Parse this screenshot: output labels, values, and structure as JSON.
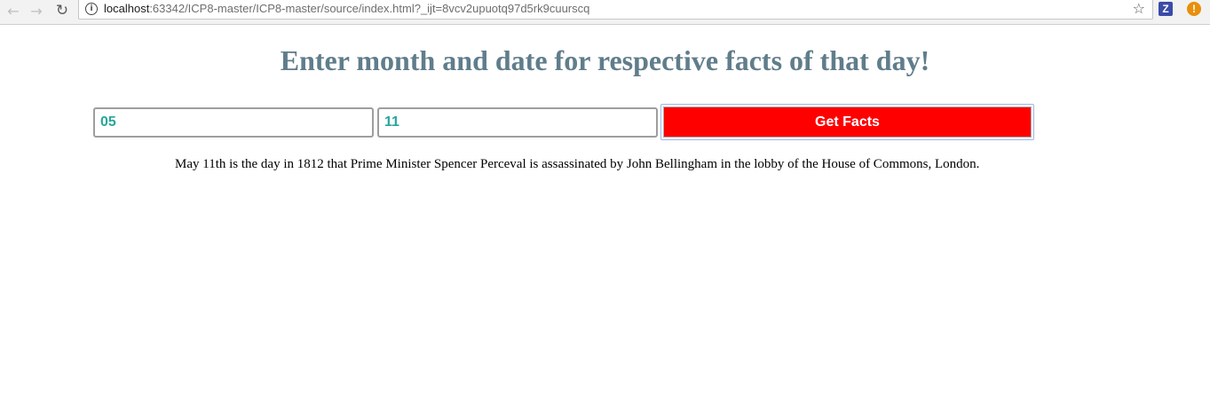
{
  "browser": {
    "url_host": "localhost",
    "url_rest": ":63342/ICP8-master/ICP8-master/source/index.html?_ijt=8vcv2upuotq97d5rk9cuurscq",
    "icons": {
      "back": "back-arrow-icon",
      "forward": "forward-arrow-icon",
      "reload": "reload-icon",
      "info": "info-icon",
      "bookmark": "star-icon",
      "extension_z": "z-extension-icon",
      "extension_alert": "alert-extension-icon"
    },
    "extension_z_label": "Z",
    "extension_alert_label": "!"
  },
  "page": {
    "heading": "Enter month and date for respective facts of that day!",
    "month_value": "05",
    "day_value": "11",
    "button_label": "Get Facts",
    "fact_text": "May 11th is the day in 1812 that Prime Minister Spencer Perceval is assassinated by John Bellingham in the lobby of the House of Commons, London."
  },
  "colors": {
    "heading": "#607d8b",
    "input_text": "#26a69a",
    "button_bg": "#ff0000",
    "button_text": "#ffffff"
  }
}
